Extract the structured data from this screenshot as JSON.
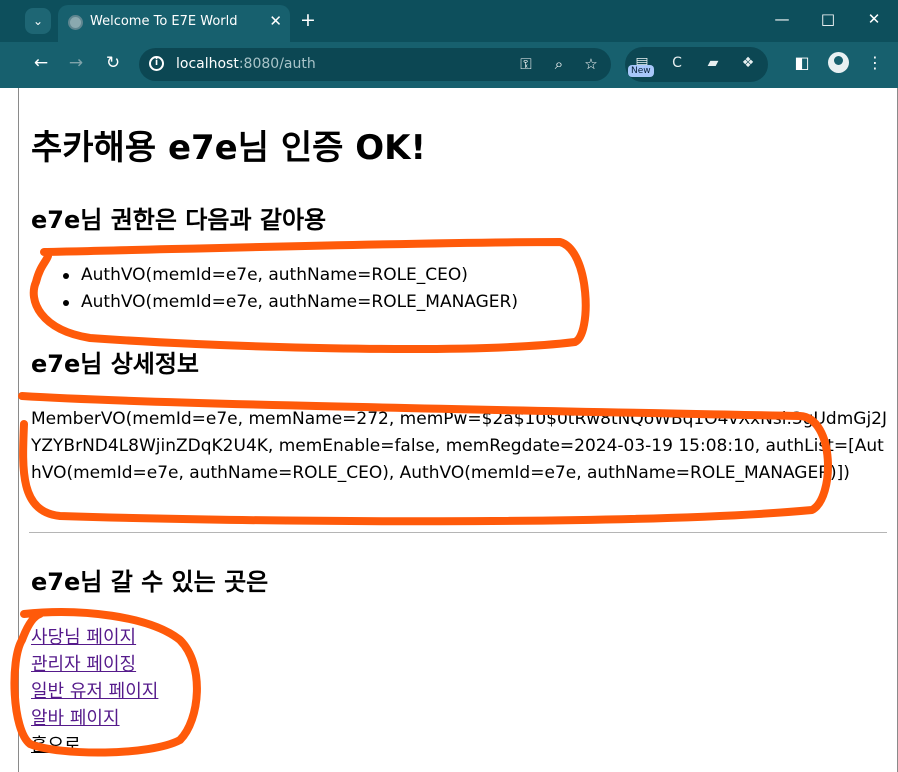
{
  "browser": {
    "tab_title": "Welcome To E7E World",
    "url_host": "localhost",
    "url_rest": ":8080/auth",
    "new_badge": "New",
    "icons": {
      "tab_search": "chevron-down-icon",
      "favicon": "globe-icon",
      "close_tab": "close-icon",
      "new_tab": "plus-icon",
      "minimize": "minimize-icon",
      "maximize": "maximize-icon",
      "close_window": "close-icon",
      "back": "arrow-left-icon",
      "forward": "arrow-right-icon",
      "reload": "reload-icon",
      "site_info": "info-icon",
      "password": "key-icon",
      "zoom": "magnify-icon",
      "bookmark": "star-icon",
      "side_panel": "side-panel-icon",
      "profile": "avatar-icon",
      "menu": "more-vertical-icon"
    },
    "colors": {
      "titlebar": "#0d4f5c",
      "toolbar": "#17606e",
      "omnibox": "#0c4753"
    }
  },
  "page": {
    "heading": "추카해용 e7e님 인증 OK!",
    "auth_heading": "e7e님 권한은 다음과 같아용",
    "auths": [
      "AuthVO(memId=e7e, authName=ROLE_CEO)",
      "AuthVO(memId=e7e, authName=ROLE_MANAGER)"
    ],
    "detail_heading": "e7e님 상세정보",
    "member_info": "MemberVO(memId=e7e, memName=272, memPw=$2a$10$0tRw8tNQoWBq1O4vXxNsi.3gUdmGj2JYZYBrND4L8WjinZDqK2U4K, memEnable=false, memRegdate=2024-03-19 15:08:10, authList=[AuthVO(memId=e7e, authName=ROLE_CEO), AuthVO(memId=e7e, authName=ROLE_MANAGER)])",
    "links_heading": "e7e님 갈 수 있는 곳은",
    "links": [
      "사당님 페이지",
      "관리자 페이징",
      "일반 유저 페이지",
      "알바 페이지",
      "홈으로"
    ],
    "annotation_color": "#ff5a0a"
  }
}
